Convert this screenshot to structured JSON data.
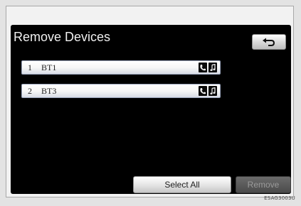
{
  "header": {
    "title": "Remove Devices",
    "back_icon": "back-arrow-icon"
  },
  "devices": [
    {
      "number": "1",
      "name": "BT1",
      "icons": [
        "phone-icon",
        "audio-icon"
      ]
    },
    {
      "number": "2",
      "name": "BT3",
      "icons": [
        "phone-icon",
        "audio-icon"
      ]
    }
  ],
  "actions": {
    "select_all_label": "Select All",
    "remove_label": "Remove"
  },
  "watermark": "ESAG3003U",
  "colors": {
    "screen_background": "#000000",
    "row_border": "#9aa4bb",
    "title_text": "#f0f0f0",
    "disabled_button": "#4b4b4b"
  }
}
